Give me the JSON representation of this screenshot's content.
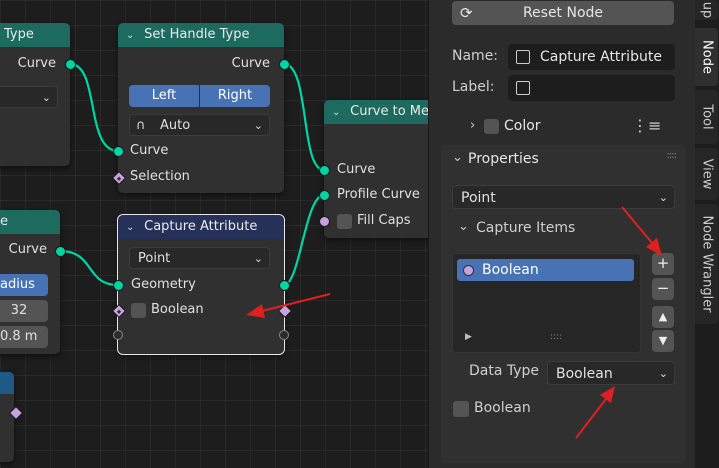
{
  "nodes": {
    "type_node": {
      "title": "Type",
      "out_curve": "Curve"
    },
    "set_handle": {
      "title": "Set Handle Type",
      "out_curve": "Curve",
      "left_label": "Left",
      "right_label": "Right",
      "mode": "Auto",
      "in_curve": "Curve",
      "in_selection": "Selection"
    },
    "curve_to_mesh": {
      "title": "Curve to Me",
      "in_curve": "Curve",
      "in_profile": "Profile Curve",
      "fill_caps": "Fill Caps"
    },
    "circle_node": {
      "title": "e",
      "out_curve": "Curve",
      "mode": "adius",
      "resolution": "32",
      "radius": "0.8 m"
    },
    "capture_attribute": {
      "title": "Capture Attribute",
      "domain": "Point",
      "geometry": "Geometry",
      "boolean": "Boolean"
    }
  },
  "sidebar": {
    "reset_node": "Reset Node",
    "name_label": "Name:",
    "name_value": "Capture Attribute",
    "label_label": "Label:",
    "label_value": "",
    "color_label": "Color",
    "properties_label": "Properties",
    "domain_value": "Point",
    "capture_items_label": "Capture Items",
    "capture_items": [
      {
        "name": "Boolean",
        "socket_color": "#c8a2e0"
      }
    ],
    "data_type_label": "Data Type",
    "data_type_value": "Boolean",
    "default_label": "Boolean"
  },
  "tabs": [
    "up",
    "Node",
    "Tool",
    "View",
    "Node Wrangler"
  ],
  "colors": {
    "geometry_socket": "#00d6a3",
    "bool_socket": "#c8a2e0",
    "accent_blue": "#4772b3",
    "arrow_red": "#e02020",
    "header_green": "#1c6b5e",
    "header_blue": "#263159"
  }
}
